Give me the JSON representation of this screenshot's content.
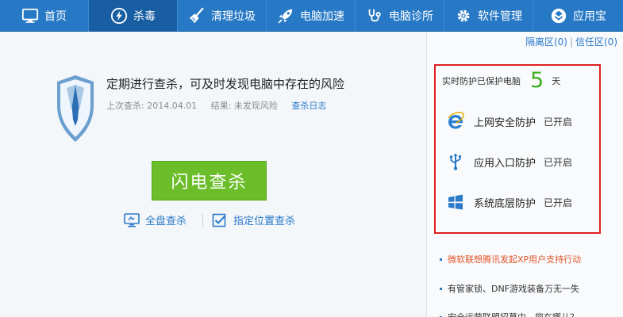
{
  "nav": {
    "tabs": [
      {
        "label": "首页",
        "icon": "monitor-icon"
      },
      {
        "label": "杀毒",
        "icon": "lightning-icon",
        "active": true
      },
      {
        "label": "清理垃圾",
        "icon": "broom-icon"
      },
      {
        "label": "电脑加速",
        "icon": "rocket-icon"
      },
      {
        "label": "电脑诊所",
        "icon": "stethoscope-icon"
      },
      {
        "label": "软件管理",
        "icon": "gear-icon"
      },
      {
        "label": "应用宝",
        "icon": "app-store-icon"
      }
    ],
    "active_color": "#195ea3",
    "bar_color": "#2779c6"
  },
  "main": {
    "headline": "定期进行查杀，可及时发现电脑中存在的风险",
    "last_scan": "上次查杀: 2014.04.01",
    "result": "结果: 未发现风险",
    "log_link": "查杀日志",
    "scan_button": "闪电查杀",
    "full_scan": "全盘查杀",
    "custom_scan": "指定位置查杀",
    "button_color": "#6cbd2a"
  },
  "side": {
    "quarantine": "隔离区(0)",
    "trust": "信任区(0)",
    "protected_label": "实时防护已保护电脑",
    "protected_days": "5",
    "days_unit": "天",
    "protections": [
      {
        "label": "上网安全防护",
        "status": "已开启",
        "icon": "ie-icon"
      },
      {
        "label": "应用入口防护",
        "status": "已开启",
        "icon": "usb-icon"
      },
      {
        "label": "系统底层防护",
        "status": "已开启",
        "icon": "windows-icon"
      }
    ],
    "news": [
      {
        "text": "微软联想腾讯发起XP用户支持行动"
      },
      {
        "text": "有管家锁、DNF游戏装备万无一失"
      },
      {
        "text": "安全运营联盟招募中，您在哪儿？"
      }
    ],
    "highlight_color": "#e02020",
    "days_color": "#3eae1e"
  }
}
